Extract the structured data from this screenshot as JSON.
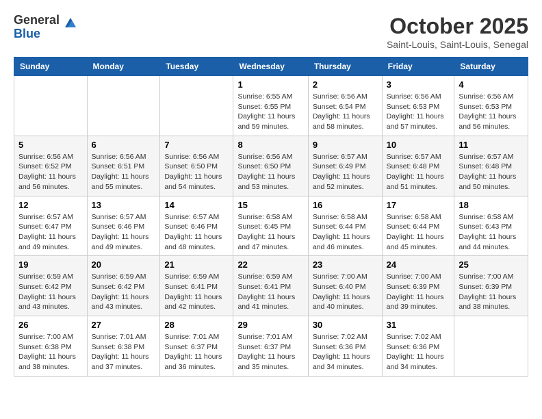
{
  "logo": {
    "general": "General",
    "blue": "Blue"
  },
  "header": {
    "month": "October 2025",
    "location": "Saint-Louis, Saint-Louis, Senegal"
  },
  "weekdays": [
    "Sunday",
    "Monday",
    "Tuesday",
    "Wednesday",
    "Thursday",
    "Friday",
    "Saturday"
  ],
  "weeks": [
    [
      {
        "day": "",
        "sunrise": "",
        "sunset": "",
        "daylight": ""
      },
      {
        "day": "",
        "sunrise": "",
        "sunset": "",
        "daylight": ""
      },
      {
        "day": "",
        "sunrise": "",
        "sunset": "",
        "daylight": ""
      },
      {
        "day": "1",
        "sunrise": "Sunrise: 6:55 AM",
        "sunset": "Sunset: 6:55 PM",
        "daylight": "Daylight: 11 hours and 59 minutes."
      },
      {
        "day": "2",
        "sunrise": "Sunrise: 6:56 AM",
        "sunset": "Sunset: 6:54 PM",
        "daylight": "Daylight: 11 hours and 58 minutes."
      },
      {
        "day": "3",
        "sunrise": "Sunrise: 6:56 AM",
        "sunset": "Sunset: 6:53 PM",
        "daylight": "Daylight: 11 hours and 57 minutes."
      },
      {
        "day": "4",
        "sunrise": "Sunrise: 6:56 AM",
        "sunset": "Sunset: 6:53 PM",
        "daylight": "Daylight: 11 hours and 56 minutes."
      }
    ],
    [
      {
        "day": "5",
        "sunrise": "Sunrise: 6:56 AM",
        "sunset": "Sunset: 6:52 PM",
        "daylight": "Daylight: 11 hours and 56 minutes."
      },
      {
        "day": "6",
        "sunrise": "Sunrise: 6:56 AM",
        "sunset": "Sunset: 6:51 PM",
        "daylight": "Daylight: 11 hours and 55 minutes."
      },
      {
        "day": "7",
        "sunrise": "Sunrise: 6:56 AM",
        "sunset": "Sunset: 6:50 PM",
        "daylight": "Daylight: 11 hours and 54 minutes."
      },
      {
        "day": "8",
        "sunrise": "Sunrise: 6:56 AM",
        "sunset": "Sunset: 6:50 PM",
        "daylight": "Daylight: 11 hours and 53 minutes."
      },
      {
        "day": "9",
        "sunrise": "Sunrise: 6:57 AM",
        "sunset": "Sunset: 6:49 PM",
        "daylight": "Daylight: 11 hours and 52 minutes."
      },
      {
        "day": "10",
        "sunrise": "Sunrise: 6:57 AM",
        "sunset": "Sunset: 6:48 PM",
        "daylight": "Daylight: 11 hours and 51 minutes."
      },
      {
        "day": "11",
        "sunrise": "Sunrise: 6:57 AM",
        "sunset": "Sunset: 6:48 PM",
        "daylight": "Daylight: 11 hours and 50 minutes."
      }
    ],
    [
      {
        "day": "12",
        "sunrise": "Sunrise: 6:57 AM",
        "sunset": "Sunset: 6:47 PM",
        "daylight": "Daylight: 11 hours and 49 minutes."
      },
      {
        "day": "13",
        "sunrise": "Sunrise: 6:57 AM",
        "sunset": "Sunset: 6:46 PM",
        "daylight": "Daylight: 11 hours and 49 minutes."
      },
      {
        "day": "14",
        "sunrise": "Sunrise: 6:57 AM",
        "sunset": "Sunset: 6:46 PM",
        "daylight": "Daylight: 11 hours and 48 minutes."
      },
      {
        "day": "15",
        "sunrise": "Sunrise: 6:58 AM",
        "sunset": "Sunset: 6:45 PM",
        "daylight": "Daylight: 11 hours and 47 minutes."
      },
      {
        "day": "16",
        "sunrise": "Sunrise: 6:58 AM",
        "sunset": "Sunset: 6:44 PM",
        "daylight": "Daylight: 11 hours and 46 minutes."
      },
      {
        "day": "17",
        "sunrise": "Sunrise: 6:58 AM",
        "sunset": "Sunset: 6:44 PM",
        "daylight": "Daylight: 11 hours and 45 minutes."
      },
      {
        "day": "18",
        "sunrise": "Sunrise: 6:58 AM",
        "sunset": "Sunset: 6:43 PM",
        "daylight": "Daylight: 11 hours and 44 minutes."
      }
    ],
    [
      {
        "day": "19",
        "sunrise": "Sunrise: 6:59 AM",
        "sunset": "Sunset: 6:42 PM",
        "daylight": "Daylight: 11 hours and 43 minutes."
      },
      {
        "day": "20",
        "sunrise": "Sunrise: 6:59 AM",
        "sunset": "Sunset: 6:42 PM",
        "daylight": "Daylight: 11 hours and 43 minutes."
      },
      {
        "day": "21",
        "sunrise": "Sunrise: 6:59 AM",
        "sunset": "Sunset: 6:41 PM",
        "daylight": "Daylight: 11 hours and 42 minutes."
      },
      {
        "day": "22",
        "sunrise": "Sunrise: 6:59 AM",
        "sunset": "Sunset: 6:41 PM",
        "daylight": "Daylight: 11 hours and 41 minutes."
      },
      {
        "day": "23",
        "sunrise": "Sunrise: 7:00 AM",
        "sunset": "Sunset: 6:40 PM",
        "daylight": "Daylight: 11 hours and 40 minutes."
      },
      {
        "day": "24",
        "sunrise": "Sunrise: 7:00 AM",
        "sunset": "Sunset: 6:39 PM",
        "daylight": "Daylight: 11 hours and 39 minutes."
      },
      {
        "day": "25",
        "sunrise": "Sunrise: 7:00 AM",
        "sunset": "Sunset: 6:39 PM",
        "daylight": "Daylight: 11 hours and 38 minutes."
      }
    ],
    [
      {
        "day": "26",
        "sunrise": "Sunrise: 7:00 AM",
        "sunset": "Sunset: 6:38 PM",
        "daylight": "Daylight: 11 hours and 38 minutes."
      },
      {
        "day": "27",
        "sunrise": "Sunrise: 7:01 AM",
        "sunset": "Sunset: 6:38 PM",
        "daylight": "Daylight: 11 hours and 37 minutes."
      },
      {
        "day": "28",
        "sunrise": "Sunrise: 7:01 AM",
        "sunset": "Sunset: 6:37 PM",
        "daylight": "Daylight: 11 hours and 36 minutes."
      },
      {
        "day": "29",
        "sunrise": "Sunrise: 7:01 AM",
        "sunset": "Sunset: 6:37 PM",
        "daylight": "Daylight: 11 hours and 35 minutes."
      },
      {
        "day": "30",
        "sunrise": "Sunrise: 7:02 AM",
        "sunset": "Sunset: 6:36 PM",
        "daylight": "Daylight: 11 hours and 34 minutes."
      },
      {
        "day": "31",
        "sunrise": "Sunrise: 7:02 AM",
        "sunset": "Sunset: 6:36 PM",
        "daylight": "Daylight: 11 hours and 34 minutes."
      },
      {
        "day": "",
        "sunrise": "",
        "sunset": "",
        "daylight": ""
      }
    ]
  ]
}
